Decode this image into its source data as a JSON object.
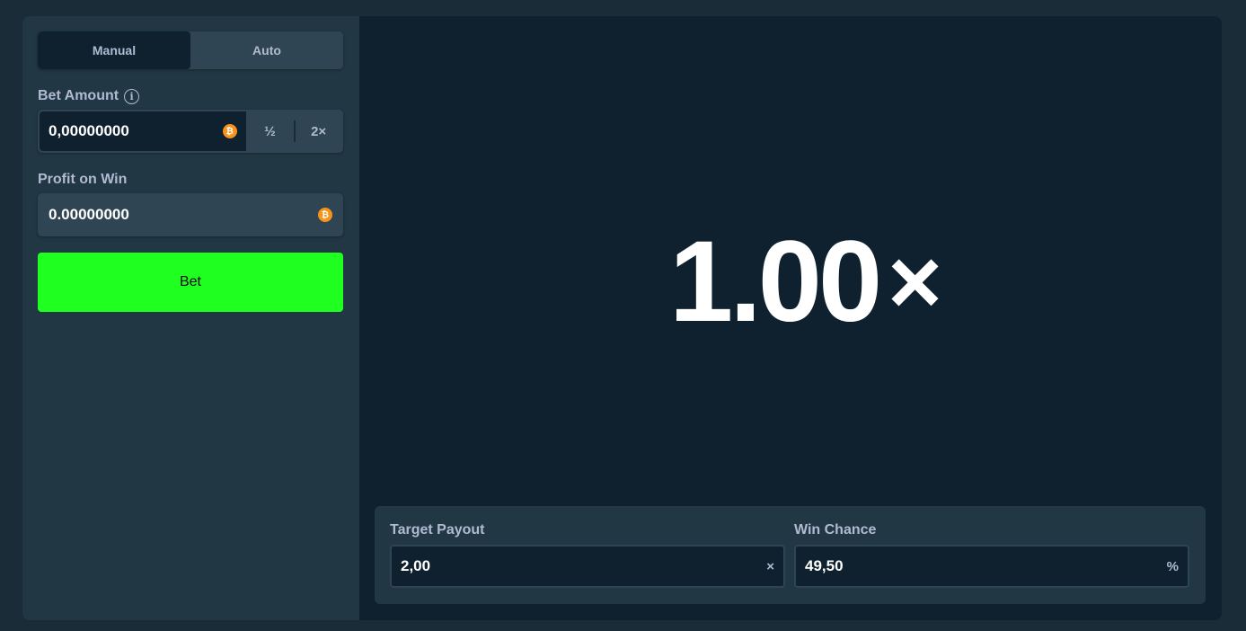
{
  "mode_tabs": {
    "manual": "Manual",
    "auto": "Auto"
  },
  "bet_amount": {
    "label": "Bet Amount",
    "value": "0,00000000",
    "currency_icon": "bitcoin-icon",
    "half_label": "½",
    "double_label": "2×"
  },
  "profit": {
    "label": "Profit on Win",
    "value": "0.00000000",
    "currency_icon": "bitcoin-icon"
  },
  "bet_button": {
    "label": "Bet"
  },
  "game": {
    "multiplier": "1.00",
    "multiplier_suffix": "×"
  },
  "target_payout": {
    "label": "Target Payout",
    "value": "2,00",
    "suffix": "×"
  },
  "win_chance": {
    "label": "Win Chance",
    "value": "49,50",
    "suffix": "%"
  },
  "colors": {
    "background": "#1a2c38",
    "sidebar": "#213743",
    "game_area": "#0f212e",
    "bet_button": "#1fff20",
    "bitcoin": "#f7931a"
  }
}
